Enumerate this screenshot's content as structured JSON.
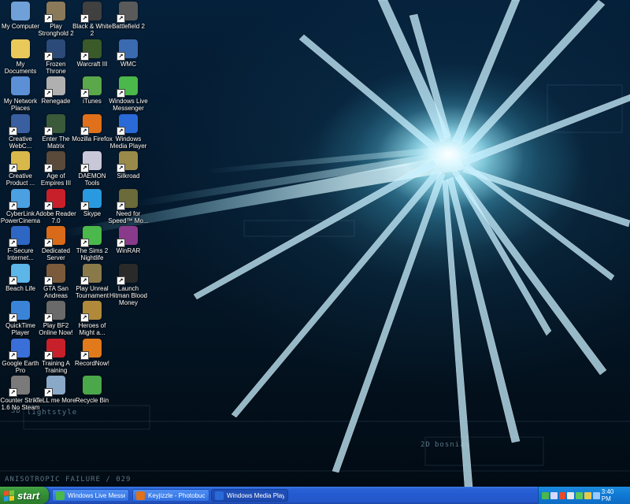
{
  "wallpaper": {
    "title": "ANISOTROPIC FAILURE / 029",
    "panel_1": "lightstyle",
    "panel_2": "bosnian",
    "badge_1": "3D",
    "badge_2": "2D"
  },
  "desktop_icons": [
    {
      "label": "My Computer",
      "icon": "computer-icon",
      "color": "#6fa0d8"
    },
    {
      "label": "My Documents",
      "icon": "folder-icon",
      "color": "#e8c95a"
    },
    {
      "label": "My Network Places",
      "icon": "network-icon",
      "color": "#5b8fd6"
    },
    {
      "label": "Creative WebC...",
      "icon": "webcam-icon",
      "color": "#3a5fa0"
    },
    {
      "label": "Creative Product ...",
      "icon": "creative-icon",
      "color": "#d8b84a"
    },
    {
      "label": "CyberLink PowerCinema",
      "icon": "cyberlink-icon",
      "color": "#4aa0e0"
    },
    {
      "label": "F-Secure Internet...",
      "icon": "fsecure-icon",
      "color": "#2e66c4"
    },
    {
      "label": "Beach Life",
      "icon": "beach-icon",
      "color": "#5cb6e8"
    },
    {
      "label": "QuickTime Player",
      "icon": "quicktime-icon",
      "color": "#3a84d8"
    },
    {
      "label": "Google Earth Pro",
      "icon": "globe-icon",
      "color": "#3a6ed8"
    },
    {
      "label": "Counter Strike 1.6 No Steam",
      "icon": "counterstrike-icon",
      "color": "#7a7a7a"
    },
    {
      "label": "Play Stronghold 2",
      "icon": "stronghold-icon",
      "color": "#8a7a5a"
    },
    {
      "label": "Frozen Throne",
      "icon": "frozenthrone-icon",
      "color": "#2b4a7a"
    },
    {
      "label": "Renegade",
      "icon": "renegade-icon",
      "color": "#b0b0b0"
    },
    {
      "label": "Enter The Matrix",
      "icon": "matrix-icon",
      "color": "#3a5a3a"
    },
    {
      "label": "Age of Empires III",
      "icon": "aoe-icon",
      "color": "#5a4a3a"
    },
    {
      "label": "Adobe Reader 7.0",
      "icon": "adobe-reader-icon",
      "color": "#c8202a"
    },
    {
      "label": "Dedicated Server",
      "icon": "halflife-icon",
      "color": "#d86a1a"
    },
    {
      "label": "GTA San Andreas",
      "icon": "gta-icon",
      "color": "#7a5a3a"
    },
    {
      "label": "Play BF2 Online Now!",
      "icon": "bf2-icon",
      "color": "#6a6a6a"
    },
    {
      "label": "Training A Training",
      "icon": "training-icon",
      "color": "#c8202a"
    },
    {
      "label": "TeLL me More",
      "icon": "tellmemore-icon",
      "color": "#8aa8c8"
    },
    {
      "label": "Black & White 2",
      "icon": "blackwhite-icon",
      "color": "#404040"
    },
    {
      "label": "Warcraft III",
      "icon": "warcraft-icon",
      "color": "#3a5a2a"
    },
    {
      "label": "iTunes",
      "icon": "itunes-icon",
      "color": "#5aa84a"
    },
    {
      "label": "Mozilla Firefox",
      "icon": "firefox-icon",
      "color": "#e0701a"
    },
    {
      "label": "DAEMON Tools",
      "icon": "daemon-icon",
      "color": "#c8c8d8"
    },
    {
      "label": "Skype",
      "icon": "skype-icon",
      "color": "#2a9ae0"
    },
    {
      "label": "The Sims 2 Nightlife",
      "icon": "sims-icon",
      "color": "#4ab84a"
    },
    {
      "label": "Play Unreal Tournament",
      "icon": "unreal-icon",
      "color": "#8a7a4a"
    },
    {
      "label": "Heroes of Might a...",
      "icon": "heroes-icon",
      "color": "#b08a3a"
    },
    {
      "label": "RecordNow!",
      "icon": "cd-icon",
      "color": "#e07a1a"
    },
    {
      "label": "Recycle Bin",
      "icon": "recycle-bin-icon",
      "color": "#4aa84a"
    },
    {
      "label": "Battlefield 2",
      "icon": "battlefield-icon",
      "color": "#5a5a5a"
    },
    {
      "label": "WMC",
      "icon": "wmc-icon",
      "color": "#3a6ab0"
    },
    {
      "label": "Windows Live Messenger",
      "icon": "messenger-icon",
      "color": "#4ab84a"
    },
    {
      "label": "Windows Media Player",
      "icon": "media-player-icon",
      "color": "#2a6ad8"
    },
    {
      "label": "Silkroad",
      "icon": "silkroad-icon",
      "color": "#9a8a4a"
    },
    {
      "label": "Need for Speed™ Mo...",
      "icon": "nfs-icon",
      "color": "#6a6a3a"
    },
    {
      "label": "WinRAR",
      "icon": "winrar-icon",
      "color": "#8a3a8a"
    },
    {
      "label": "Launch Hitman Blood Money",
      "icon": "hitman-icon",
      "color": "#2a2a2a"
    }
  ],
  "taskbar": {
    "start_label": "start",
    "buttons": [
      {
        "label": "Windows Live Messen...",
        "icon": "messenger-icon",
        "color": "#4ab84a",
        "active": false
      },
      {
        "label": "Keyjizzle - Photobuck...",
        "icon": "firefox-icon",
        "color": "#e0701a",
        "active": false
      },
      {
        "label": "Windows Media Player",
        "icon": "media-player-icon",
        "color": "#2a6ad8",
        "active": true
      }
    ],
    "tray_icons": [
      {
        "name": "messenger-tray-icon",
        "color": "#4ab84a"
      },
      {
        "name": "network-tray-icon",
        "color": "#d8d8ff"
      },
      {
        "name": "security-tray-icon",
        "color": "#e84a2a"
      },
      {
        "name": "volume-tray-icon",
        "color": "#e8e8e8"
      },
      {
        "name": "sync-tray-icon",
        "color": "#5ac85a"
      },
      {
        "name": "update-tray-icon",
        "color": "#e8c84a"
      },
      {
        "name": "display-tray-icon",
        "color": "#9ac8ff"
      }
    ],
    "clock": "3:40 PM"
  }
}
